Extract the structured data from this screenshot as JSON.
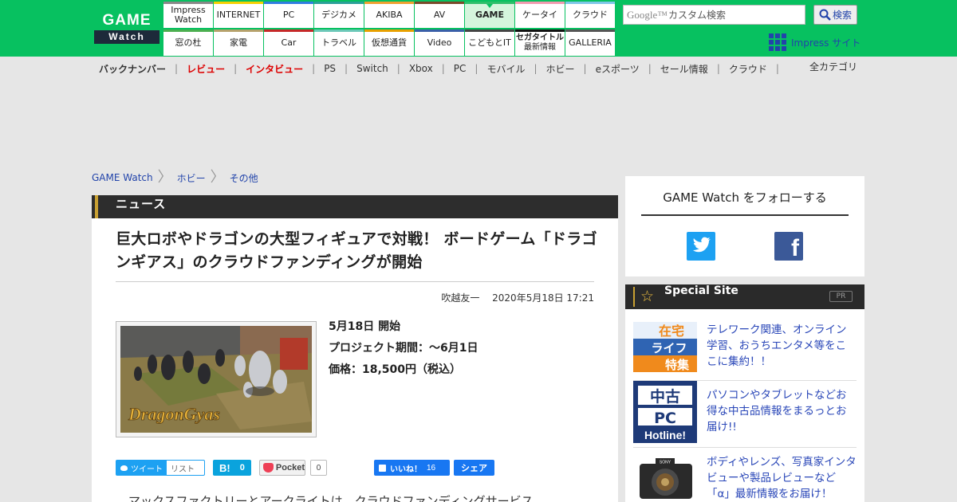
{
  "header": {
    "logo": {
      "line1": "GAME",
      "line2": "Watch"
    },
    "nav_top": [
      {
        "label": "Impress\nWatch",
        "color": "#888888",
        "active": false
      },
      {
        "label": "INTERNET",
        "color": "#f5d000",
        "active": false
      },
      {
        "label": "PC",
        "color": "#2f7de1",
        "active": false
      },
      {
        "label": "デジカメ",
        "color": "#2aa198",
        "active": false
      },
      {
        "label": "AKIBA",
        "color": "#f0a030",
        "active": false
      },
      {
        "label": "AV",
        "color": "#7a4a2a",
        "active": false
      },
      {
        "label": "GAME",
        "color": "#2dbf6a",
        "active": true
      },
      {
        "label": "ケータイ",
        "color": "#f29ab0",
        "active": false
      },
      {
        "label": "クラウド",
        "color": "#7fc7e8",
        "active": false
      }
    ],
    "nav_bottom": [
      {
        "label": "窓の杜",
        "color": "#4caf50"
      },
      {
        "label": "家電",
        "color": "#b6a16c"
      },
      {
        "label": "Car",
        "color": "#c62828"
      },
      {
        "label": "トラベル",
        "color": "#6cc8b8"
      },
      {
        "label": "仮想通貨",
        "color": "#e8a000"
      },
      {
        "label": "Video",
        "color": "#3a5fa8"
      },
      {
        "label": "こどもとIT",
        "color": "#444444"
      },
      {
        "label": "セガタイトル\n最新情報",
        "color": "#111111"
      },
      {
        "label": "GALLERIA",
        "color": "#555555"
      }
    ],
    "search": {
      "brand": "Google™",
      "placeholder": "カスタム検索",
      "button": "検索"
    },
    "impress_sites": "Impress サイト"
  },
  "subnav": {
    "items": [
      "バックナンバー",
      "レビュー",
      "インタビュー",
      "PS",
      "Switch",
      "Xbox",
      "PC",
      "モバイル",
      "ホビー",
      "eスポーツ",
      "セール情報",
      "クラウド"
    ],
    "highlight_red": [
      "レビュー",
      "インタビュー"
    ],
    "bold": [
      "バックナンバー"
    ],
    "all_categories": "全カテゴリ"
  },
  "breadcrumb": [
    "GAME Watch",
    "ホビー",
    "その他"
  ],
  "section_label": "ニュース",
  "article": {
    "title": "巨大ロボやドラゴンの大型フィギュアで対戦！ ボードゲーム「ドラゴンギアス」のクラウドファンディングが開始",
    "author": "吹越友一",
    "date": "2020年5月18日 17:21",
    "image_caption_logo": "DragonGyas",
    "facts": [
      "5月18日 開始",
      "プロジェクト期間：〜6月1日",
      "価格：18,500円（税込）"
    ],
    "body_start": "マックスファクトリーとアークライトは、クラウドファンディングサービス"
  },
  "social": {
    "tweet": "ツイート",
    "list": "リスト",
    "hatena_logo": "B!",
    "hatena_count": "0",
    "pocket": "Pocket",
    "pocket_count": "0",
    "fb_like": "いいね！",
    "fb_count": "16",
    "share": "シェア"
  },
  "follow": {
    "heading": "GAME Watch をフォローする",
    "twitter_icon": "twitter-icon",
    "facebook_icon": "facebook-icon"
  },
  "special": {
    "heading": "Special Site",
    "pr": "PR",
    "items": [
      {
        "thumb_lines": [
          "在宅",
          "ライフ",
          "特集"
        ],
        "text": "テレワーク関連、オンライン学習、おうちエンタメ等をここに集約！！"
      },
      {
        "thumb_lines": [
          "中古",
          "PC",
          "Hotline!"
        ],
        "text": "パソコンやタブレットなどお得な中古品情報をまるっとお届け!!"
      },
      {
        "thumb_lines": [
          "SONY"
        ],
        "text": "ボディやレンズ、写真家インタビューや製品レビューなど「α」最新情報をお届け！"
      }
    ]
  },
  "colors": {
    "brand_green": "#07c160",
    "link_blue": "#2244aa",
    "dark_bar": "#2d2d2d",
    "accent_gold": "#c8a032",
    "twitter": "#1da1f2",
    "facebook": "#1877f2",
    "hatena": "#0aa3dd",
    "pocket": "#ee4056"
  }
}
